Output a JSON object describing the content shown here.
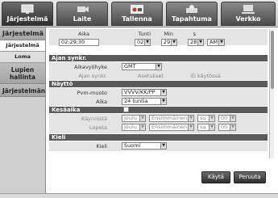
{
  "tabs": [
    {
      "label": "Järjestelmä",
      "icon": "monitor-icon"
    },
    {
      "label": "Laite",
      "icon": "camera-icon"
    },
    {
      "label": "Tallenna",
      "icon": "record-icon"
    },
    {
      "label": "Tapahtuma",
      "icon": "alarm-icon"
    },
    {
      "label": "Verkko",
      "icon": "network-icon"
    }
  ],
  "sidebar": {
    "header": "Järjestelmä",
    "items": [
      "Järjestelmä",
      "Loma"
    ],
    "section2": "Lupien hallinta",
    "section3": "Järjestelmän"
  },
  "time": {
    "col_aika": "Aika",
    "col_tunti": "Tunti",
    "col_min": "Min",
    "col_s": "s",
    "value": "02:29:30",
    "hour": "02",
    "minute": "29",
    "second": "28",
    "ampm": "AM"
  },
  "sync": {
    "title": "Ajan synkr.",
    "tz_label": "Aikavyöhyke",
    "tz_value": "GMT",
    "sync_label": "Ajan synkr.",
    "settings": "Asetukset",
    "status": "Ei käytössä"
  },
  "display": {
    "title": "Näyttö",
    "date_label": "Pvm-muoto",
    "date_value": "VVVV/KK/PP",
    "time_label": "Aika",
    "time_value": "24 tuntia"
  },
  "dst": {
    "title": "Kesäaika",
    "start_label": "Käynnistä",
    "end_label": "Lopeta",
    "month": "joulu",
    "week": "Ensimmäinen",
    "day": "su",
    "hour": "00"
  },
  "lang": {
    "title": "Kieli",
    "label": "Kieli",
    "value": "Suomi"
  },
  "buttons": {
    "apply": "Käytä",
    "cancel": "Peruuta"
  }
}
